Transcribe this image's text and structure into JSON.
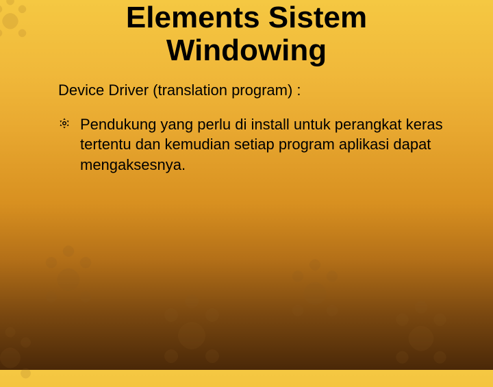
{
  "title": "Elements Sistem Windowing",
  "subtitle": "Device Driver (translation program) :",
  "bullet": {
    "text": "Pendukung yang perlu di install untuk perangkat keras tertentu dan kemudian setiap program aplikasi dapat mengaksesnya."
  }
}
